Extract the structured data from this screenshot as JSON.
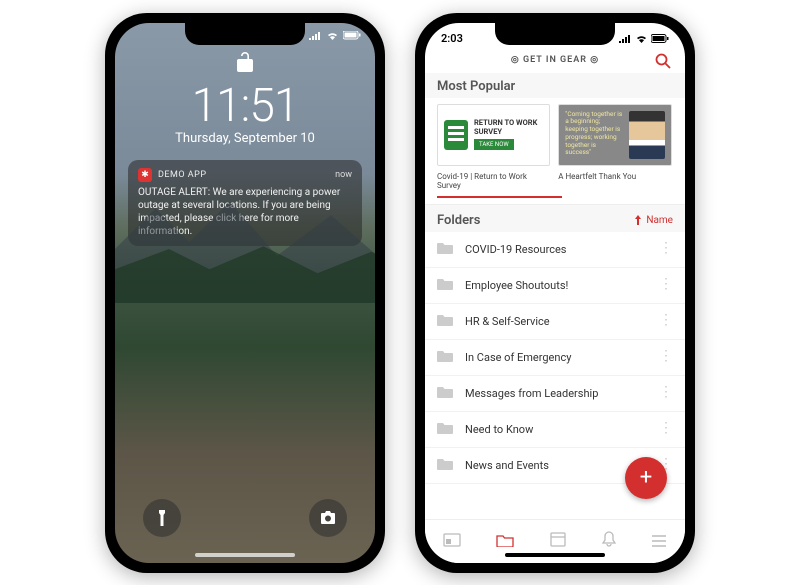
{
  "phone1": {
    "time": "11:51",
    "date": "Thursday, September 10",
    "status": {
      "signal": "•••",
      "wifi": "wifi",
      "battery": "battery"
    },
    "notification": {
      "app_name": "DEMO APP",
      "timestamp": "now",
      "body": "OUTAGE ALERT: We are experiencing a power outage at several locations. If you are being impacted, please click here for more information."
    }
  },
  "phone2": {
    "status_time": "2:03",
    "header_title": "◎ GET IN GEAR ◎",
    "section_popular": "Most Popular",
    "card1": {
      "line1": "RETURN TO WORK",
      "line2": "SURVEY",
      "cta": "TAKE NOW",
      "caption": "Covid-19 | Return to Work Survey"
    },
    "card2": {
      "quote": "\"Coming together is a beginning; keeping together is progress; working together is success\"",
      "caption": "A Heartfelt Thank You"
    },
    "folders_title": "Folders",
    "sort_label": "Name",
    "folders": [
      "COVID-19 Resources",
      "Employee Shoutouts!",
      "HR & Self-Service",
      "In Case of Emergency",
      "Messages from Leadership",
      "Need to Know",
      "News and Events"
    ]
  }
}
